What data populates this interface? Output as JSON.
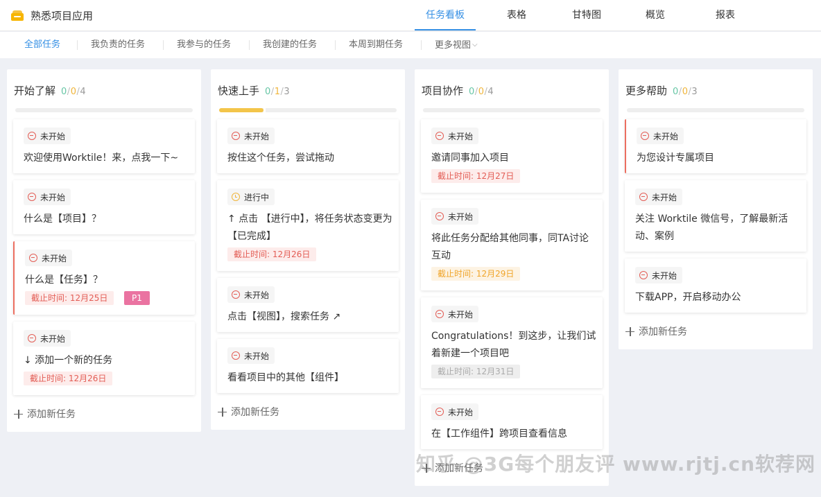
{
  "header": {
    "project_title": "熟悉项目应用",
    "tabs": [
      "任务看板",
      "表格",
      "甘特图",
      "概览",
      "报表"
    ],
    "active_tab": "任务看板"
  },
  "subnav": {
    "items": [
      "全部任务",
      "我负责的任务",
      "我参与的任务",
      "我创建的任务",
      "本周到期任务",
      "更多视图"
    ],
    "active": "全部任务"
  },
  "add_task_label": "添加新任务",
  "colors": {
    "accent": "#348fe4",
    "not_started": "#e35d55",
    "in_progress": "#f0b53a",
    "priority_p1": "#ea73a1"
  },
  "columns": [
    {
      "title": "开始了解",
      "count_done": "0",
      "count_progress": "0",
      "count_total": "4",
      "progress": 0,
      "cards": [
        {
          "status": "未开始",
          "title": "欢迎使用Worktile！来，点我一下~"
        },
        {
          "status": "未开始",
          "title": "什么是【项目】？"
        },
        {
          "status": "未开始",
          "title": "什么是【任务】？",
          "due": "截止时间: 12月25日",
          "priority": "P1"
        },
        {
          "status": "未开始",
          "title": "↓ 添加一个新的任务",
          "due": "截止时间: 12月26日"
        }
      ]
    },
    {
      "title": "快速上手",
      "count_done": "0",
      "count_progress": "1",
      "count_total": "3",
      "progress": 0.25,
      "cards": [
        {
          "status": "未开始",
          "title": "按住这个任务，尝试拖动"
        },
        {
          "status": "进行中",
          "title": "↑ 点击 【进行中】，将任务状态变更为 【已完成】",
          "due": "截止时间: 12月26日"
        },
        {
          "status": "未开始",
          "title": "点击【视图】，搜索任务 ↗"
        },
        {
          "status": "未开始",
          "title": "看看项目中的其他【组件】"
        }
      ]
    },
    {
      "title": "项目协作",
      "count_done": "0",
      "count_progress": "0",
      "count_total": "4",
      "progress": 0,
      "cards": [
        {
          "status": "未开始",
          "title": "邀请同事加入项目",
          "due": "截止时间: 12月27日"
        },
        {
          "status": "未开始",
          "title": "将此任务分配给其他同事，同TA讨论互动",
          "due": "截止时间: 12月29日"
        },
        {
          "status": "未开始",
          "title": "Congratulations！到这步，让我们试着新建一个项目吧",
          "due": "截止时间: 12月31日"
        },
        {
          "status": "未开始",
          "title": "在【工作组件】跨项目查看信息"
        }
      ]
    },
    {
      "title": "更多帮助",
      "count_done": "0",
      "count_progress": "0",
      "count_total": "3",
      "progress": 0,
      "cards": [
        {
          "status": "未开始",
          "title": "为您设计专属项目"
        },
        {
          "status": "未开始",
          "title": "关注 Worktile 微信号，了解最新活动、案例"
        },
        {
          "status": "未开始",
          "title": "下载APP，开启移动办公"
        }
      ]
    }
  ],
  "watermark": "知乎 @3G每个朋友评 www.rjtj.cn软荐网"
}
